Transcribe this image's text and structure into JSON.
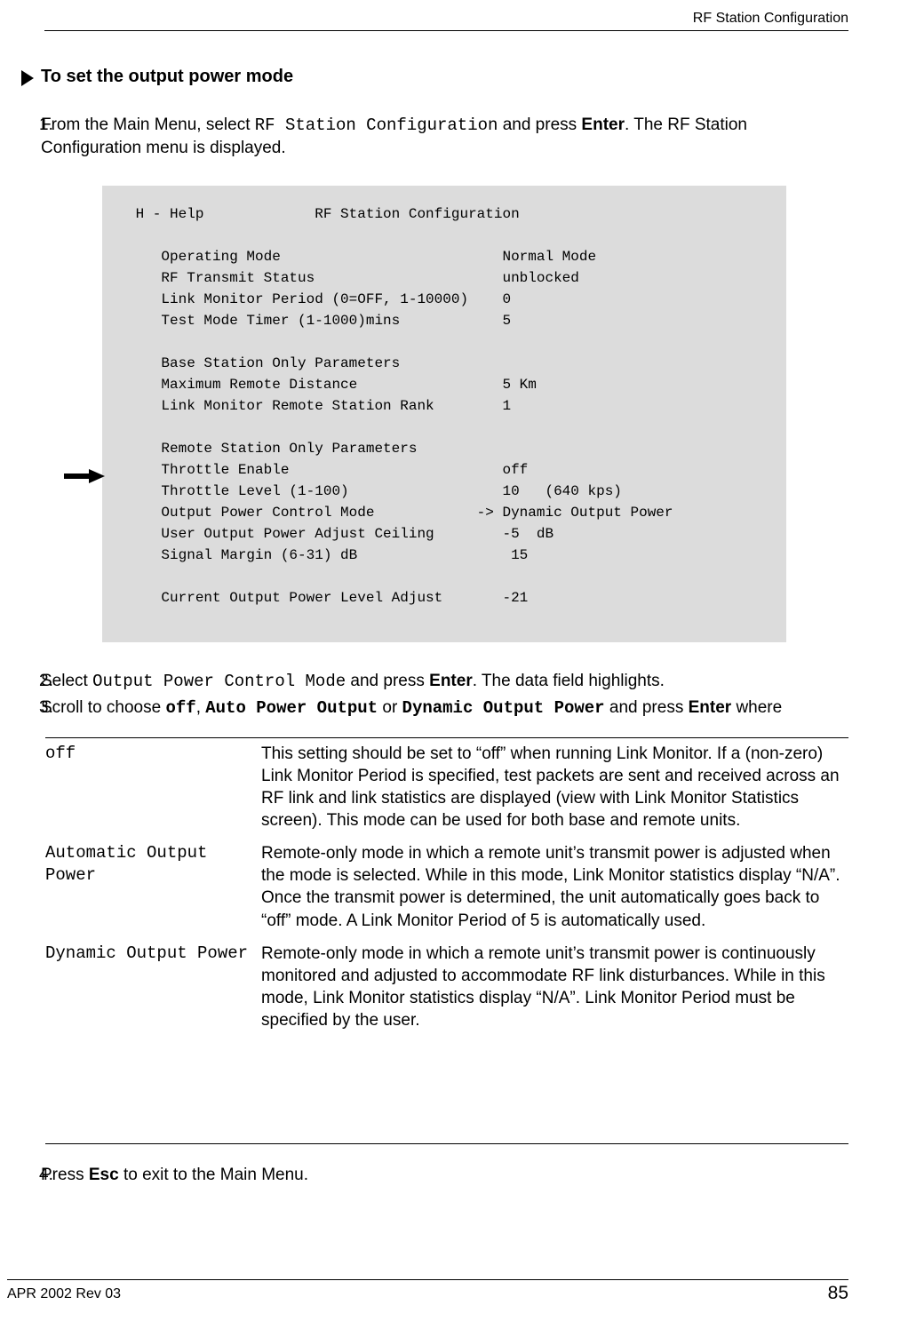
{
  "header": {
    "right": "RF Station Configuration"
  },
  "section": {
    "title": "To set the output power mode"
  },
  "steps": {
    "s1": {
      "num": "1.",
      "pre": "From the Main Menu, select ",
      "code": "RF Station Configuration",
      "mid": " and press ",
      "key": "Enter",
      "post": ". The RF Station Configuration menu is displayed."
    },
    "s2": {
      "num": "2.",
      "pre": "Select ",
      "code": "Output Power Control Mode",
      "mid": " and press ",
      "key": "Enter",
      "post": ". The data field highlights."
    },
    "s3": {
      "num": "3.",
      "pre": "Scroll to choose ",
      "c1": "off",
      "sep1": ", ",
      "c2": "Auto Power Output",
      "sep2": " or ",
      "c3": "Dynamic Output Power",
      "mid": " and press ",
      "key": "Enter",
      "post": " where"
    },
    "s4": {
      "num": "4.",
      "pre": "Press ",
      "key": "Esc",
      "post": " to exit to the Main Menu."
    }
  },
  "screen": {
    "text": " H - Help             RF Station Configuration\n\n    Operating Mode                          Normal Mode\n    RF Transmit Status                      unblocked\n    Link Monitor Period (0=OFF, 1-10000)    0\n    Test Mode Timer (1-1000)mins            5\n\n    Base Station Only Parameters\n    Maximum Remote Distance                 5 Km\n    Link Monitor Remote Station Rank        1\n\n    Remote Station Only Parameters\n    Throttle Enable                         off\n    Throttle Level (1-100)                  10   (640 kps)\n    Output Power Control Mode            -> Dynamic Output Power\n    User Output Power Adjust Ceiling        -5  dB\n    Signal Margin (6-31) dB                  15\n\n    Current Output Power Level Adjust       -21"
  },
  "table": {
    "rows": [
      {
        "name": "off",
        "desc": "This setting should be set to “off” when running Link Monitor. If a (non-zero) Link Monitor Period is specified, test packets are sent and received across an RF link and link statistics are displayed (view with Link Monitor Statistics screen). This mode can be used for both base and remote units."
      },
      {
        "name": "Automatic Output Power",
        "desc": "Remote-only mode in which a remote unit’s transmit power is adjusted when the mode is selected. While in this mode, Link Monitor statistics display “N/A”. Once the transmit power is determined, the unit automatically goes back to “off” mode. A Link Monitor Period of 5 is automatically used."
      },
      {
        "name": "Dynamic Output Power",
        "desc": "Remote-only mode in which a remote unit’s transmit power is continuously monitored and adjusted to accommodate RF link disturbances. While in this mode, Link Monitor statistics display “N/A”. Link Monitor Period must be specified by the user."
      }
    ]
  },
  "footer": {
    "left": "APR 2002 Rev 03",
    "right": "85"
  }
}
